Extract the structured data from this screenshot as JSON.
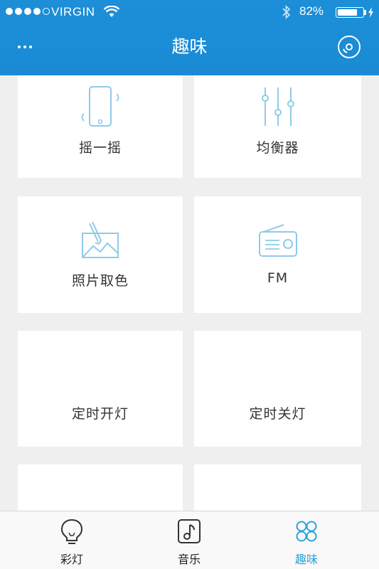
{
  "status_bar": {
    "carrier": "VIRGIN",
    "signal_bars": 4,
    "signal_max": 5,
    "battery_text": "82%",
    "battery_level": 0.82
  },
  "nav": {
    "title": "趣味"
  },
  "tiles": [
    {
      "label": "摇一摇",
      "icon": "phone-shake-icon"
    },
    {
      "label": "均衡器",
      "icon": "equalizer-icon"
    },
    {
      "label": "照片取色",
      "icon": "photo-pick-icon"
    },
    {
      "label": "FM",
      "icon": "radio-icon"
    },
    {
      "label": "定时开灯",
      "icon": ""
    },
    {
      "label": "定时关灯",
      "icon": ""
    }
  ],
  "tabs": [
    {
      "label": "彩灯",
      "icon": "bulb-icon",
      "active": false
    },
    {
      "label": "音乐",
      "icon": "music-icon",
      "active": false
    },
    {
      "label": "趣味",
      "icon": "clover-icon",
      "active": true
    }
  ],
  "colors": {
    "header": "#1c8fd8",
    "accent": "#2aa3d9",
    "icon_line": "#8fcbe8",
    "background": "#efefef"
  }
}
